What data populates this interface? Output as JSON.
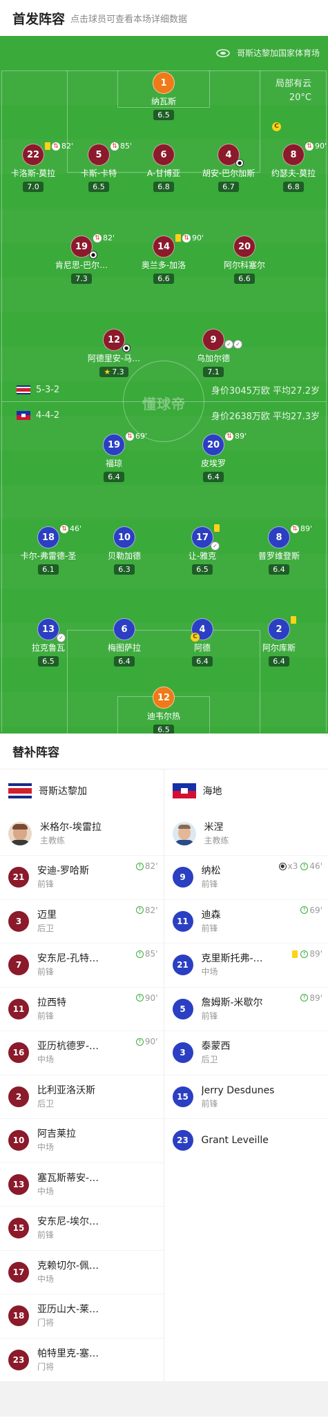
{
  "header": {
    "title": "首发阵容",
    "subtitle": "点击球员可查看本场详细数据"
  },
  "pitch": {
    "venue": "哥斯达黎加国家体育场",
    "weather": "局部有云",
    "temp": "20°C",
    "watermark": "懂球帝",
    "home": {
      "formation": "5-3-2",
      "meta": "身价3045万欧 平均27.2岁"
    },
    "away": {
      "formation": "4-4-2",
      "meta": "身价2638万欧 平均27.3岁"
    }
  },
  "home_players": [
    {
      "num": "1",
      "name": "纳瓦斯",
      "rating": "6.5"
    },
    {
      "num": "22",
      "name": "卡洛斯-莫拉",
      "rating": "7.0",
      "ev": "82'"
    },
    {
      "num": "5",
      "name": "卡斯-卡特",
      "rating": "6.5",
      "ev": "85'"
    },
    {
      "num": "6",
      "name": "A-甘博亚",
      "rating": "6.8"
    },
    {
      "num": "4",
      "name": "胡安-巴尔加斯",
      "rating": "6.7"
    },
    {
      "num": "8",
      "name": "约瑟夫-莫拉",
      "rating": "6.8",
      "ev": "90'"
    },
    {
      "num": "19",
      "name": "肯尼思-巴尔…",
      "rating": "7.3",
      "ev": "82'"
    },
    {
      "num": "14",
      "name": "奥兰多-加洛",
      "rating": "6.6",
      "ev": "90'"
    },
    {
      "num": "20",
      "name": "阿尔科塞尔",
      "rating": "6.6"
    },
    {
      "num": "12",
      "name": "阿德里安-马…",
      "rating": "7.3"
    },
    {
      "num": "9",
      "name": "乌加尔德",
      "rating": "7.1"
    }
  ],
  "away_players": [
    {
      "num": "19",
      "name": "福琼",
      "rating": "6.4",
      "ev": "69'"
    },
    {
      "num": "20",
      "name": "皮埃罗",
      "rating": "6.4",
      "ev": "89'"
    },
    {
      "num": "18",
      "name": "卡尔-弗雷德-圣",
      "rating": "6.1",
      "ev": "46'"
    },
    {
      "num": "10",
      "name": "贝勒加德",
      "rating": "6.3"
    },
    {
      "num": "17",
      "name": "让-雅克",
      "rating": "6.5"
    },
    {
      "num": "8",
      "name": "普罗维登斯",
      "rating": "6.4",
      "ev": "89'"
    },
    {
      "num": "13",
      "name": "拉克鲁瓦",
      "rating": "6.5"
    },
    {
      "num": "6",
      "name": "梅图萨拉",
      "rating": "6.4"
    },
    {
      "num": "4",
      "name": "阿德",
      "rating": "6.4"
    },
    {
      "num": "2",
      "name": "阿尔库斯",
      "rating": "6.4"
    },
    {
      "num": "12",
      "name": "迪韦尔热",
      "rating": "6.5"
    }
  ],
  "subs": {
    "title": "替补阵容",
    "home": {
      "team": "哥斯达黎加",
      "coach": {
        "name": "米格尔-埃雷拉",
        "role": "主教练"
      },
      "players": [
        {
          "num": "21",
          "name": "安迪-罗哈斯",
          "pos": "前锋",
          "ev": "82'"
        },
        {
          "num": "3",
          "name": "迈里",
          "pos": "后卫",
          "ev": "82'"
        },
        {
          "num": "7",
          "name": "安东尼-孔特…",
          "pos": "前锋",
          "ev": "85'"
        },
        {
          "num": "11",
          "name": "拉西特",
          "pos": "前锋",
          "ev": "90'"
        },
        {
          "num": "16",
          "name": "亚历杭德罗-…",
          "pos": "中场",
          "ev": "90'"
        },
        {
          "num": "2",
          "name": "比利亚洛沃斯",
          "pos": "后卫"
        },
        {
          "num": "10",
          "name": "阿吉莱拉",
          "pos": "中场"
        },
        {
          "num": "13",
          "name": "塞瓦斯蒂安-…",
          "pos": "中场"
        },
        {
          "num": "15",
          "name": "安东尼-埃尔…",
          "pos": "前锋"
        },
        {
          "num": "17",
          "name": "克赖切尔-佩…",
          "pos": "中场"
        },
        {
          "num": "18",
          "name": "亚历山大-莱…",
          "pos": "门将"
        },
        {
          "num": "23",
          "name": "帕特里克-塞…",
          "pos": "门将"
        }
      ]
    },
    "away": {
      "team": "海地",
      "coach": {
        "name": "米涅",
        "role": "主教练"
      },
      "players": [
        {
          "num": "9",
          "name": "纳松",
          "pos": "前锋",
          "ev": "46'",
          "goals": "x3"
        },
        {
          "num": "11",
          "name": "迪森",
          "pos": "前锋",
          "ev": "69'"
        },
        {
          "num": "21",
          "name": "克里斯托弗-…",
          "pos": "中场",
          "ev": "89'"
        },
        {
          "num": "5",
          "name": "詹姆斯-米歇尔",
          "pos": "前锋",
          "ev": "89'"
        },
        {
          "num": "3",
          "name": "泰蒙西",
          "pos": "后卫"
        },
        {
          "num": "15",
          "name": "Jerry Desdunes",
          "pos": "前锋"
        },
        {
          "num": "23",
          "name": "Grant Leveille",
          "pos": ""
        }
      ]
    }
  },
  "colors": {
    "pitch": "#3aaa3a",
    "home": "#8b1a2b",
    "away": "#2b3fc2",
    "gk": "#f07a18"
  }
}
